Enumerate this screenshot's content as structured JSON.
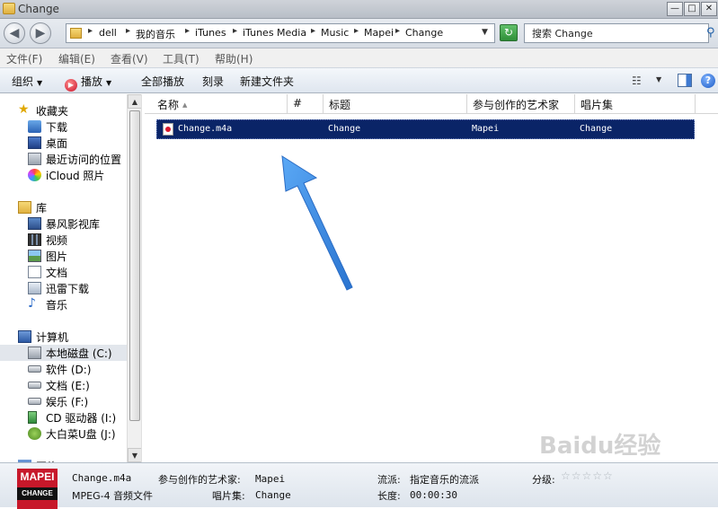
{
  "window": {
    "title": "Change",
    "minimize": "—",
    "maximize": "□",
    "close": "✕"
  },
  "nav": {
    "back": "◀",
    "forward": "▶"
  },
  "address": {
    "crumbs": [
      "dell",
      "我的音乐",
      "iTunes",
      "iTunes Media",
      "Music",
      "Mapei",
      "Change"
    ],
    "refresh": "↻"
  },
  "search": {
    "value": "搜索 Change"
  },
  "menu": [
    "文件(F)",
    "编辑(E)",
    "查看(V)",
    "工具(T)",
    "帮助(H)"
  ],
  "toolbar": {
    "organize": "组织",
    "play": "播放",
    "play_all": "全部播放",
    "burn": "刻录",
    "new_folder": "新建文件夹"
  },
  "navpane": {
    "favorites": {
      "label": "收藏夹",
      "items": [
        "下载",
        "桌面",
        "最近访问的位置",
        "iCloud 照片"
      ]
    },
    "libraries": {
      "label": "库",
      "items": [
        "暴风影视库",
        "视频",
        "图片",
        "文档",
        "迅雷下载",
        "音乐"
      ]
    },
    "computer": {
      "label": "计算机",
      "items": [
        "本地磁盘 (C:)",
        "软件 (D:)",
        "文档 (E:)",
        "娱乐 (F:)",
        "CD 驱动器 (I:)",
        "大白菜U盘 (J:)"
      ]
    },
    "network": {
      "label": "网络"
    }
  },
  "columns": [
    "名称",
    "#",
    "标题",
    "参与创作的艺术家",
    "唱片集"
  ],
  "files": [
    {
      "name": "Change.m4a",
      "number": "",
      "title": "Change",
      "artist": "Mapei",
      "album": "Change"
    }
  ],
  "details": {
    "album_art_top": "MAPEI",
    "album_art_bottom": "CHANGE",
    "filename": "Change.m4a",
    "filetype": "MPEG-4 音频文件",
    "artist_label": "参与创作的艺术家:",
    "artist_value": "Mapei",
    "album_label": "唱片集:",
    "album_value": "Change",
    "genre_label": "流派:",
    "genre_value": "指定音乐的流派",
    "length_label": "长度:",
    "length_value": "00:00:30",
    "rating_label": "分级:",
    "rating_stars": "☆☆☆☆☆"
  },
  "watermark": "Baidu经验",
  "colors": {
    "selection": "#0a2467",
    "arrow": "#3d8fe8"
  }
}
